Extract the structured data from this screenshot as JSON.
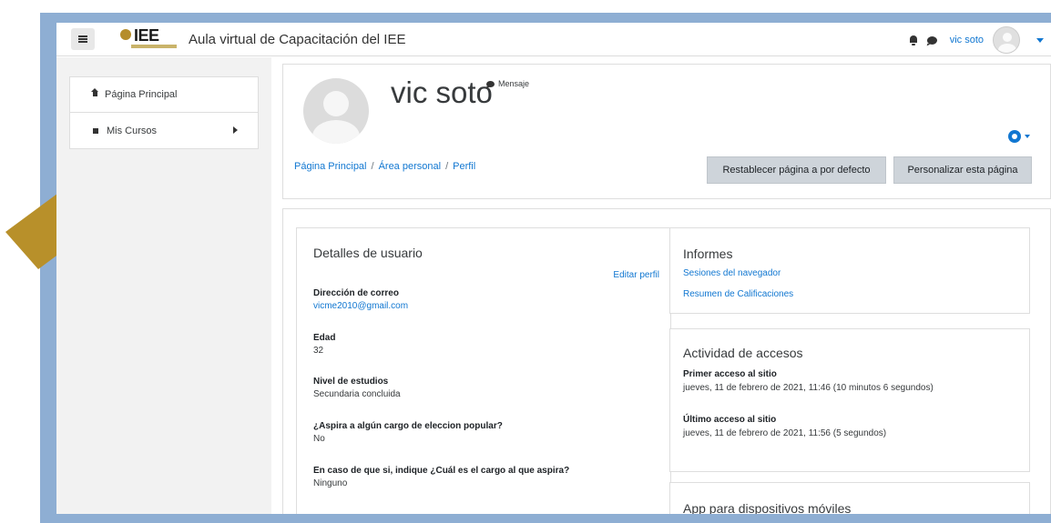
{
  "navbar": {
    "logo_text": "IEE",
    "site_name": "Aula virtual de Capacitación del IEE",
    "user_name": "vic soto",
    "icons": [
      "menu-icon",
      "bell-icon",
      "chat-icon",
      "avatar",
      "chevron-down-icon"
    ]
  },
  "drawer": {
    "items": [
      {
        "label": "Página Principal",
        "icon": "home-icon"
      },
      {
        "label": "Mis Cursos",
        "icon": "square-icon"
      }
    ]
  },
  "profile": {
    "name": "vic soto",
    "message_label": "Mensaje"
  },
  "breadcrumb": [
    "Página Principal",
    "Área personal",
    "Perfil"
  ],
  "breadcrumb_separator": "/",
  "buttons": {
    "reset": "Restablecer página a por defecto",
    "customize": "Personalizar esta página"
  },
  "details": {
    "title": "Detalles de usuario",
    "edit_link": "Editar perfil",
    "fields": [
      {
        "label": "Dirección de correo",
        "value": "vicme2010@gmail.com"
      },
      {
        "label": "Edad",
        "value": "32"
      },
      {
        "label": "Nivel de estudios",
        "value": "Secundaria concluida"
      },
      {
        "label": "¿Aspira a algún cargo de eleccion popular?",
        "value": "No"
      },
      {
        "label": "En caso de que si, indique ¿Cuál es el cargo al que aspira?",
        "value": "Ninguno"
      }
    ]
  },
  "informes": {
    "title": "Informes",
    "links": [
      "Sesiones del navegador",
      "Resumen de Calificaciones"
    ]
  },
  "actividad": {
    "title": "Actividad de accesos",
    "items": [
      {
        "label": "Primer acceso al sitio",
        "value": "jueves, 11 de febrero de 2021, 11:46  (10 minutos 6 segundos)"
      },
      {
        "label": "Último acceso al sitio",
        "value": "jueves, 11 de febrero de 2021, 11:56  (5 segundos)"
      }
    ]
  },
  "app": {
    "title": "App para dispositivos móviles"
  },
  "colors": {
    "frame": "#8eaed3",
    "link": "#1177d1",
    "annotation_arrow": "#b8902a",
    "button_bg": "#ced4da"
  }
}
